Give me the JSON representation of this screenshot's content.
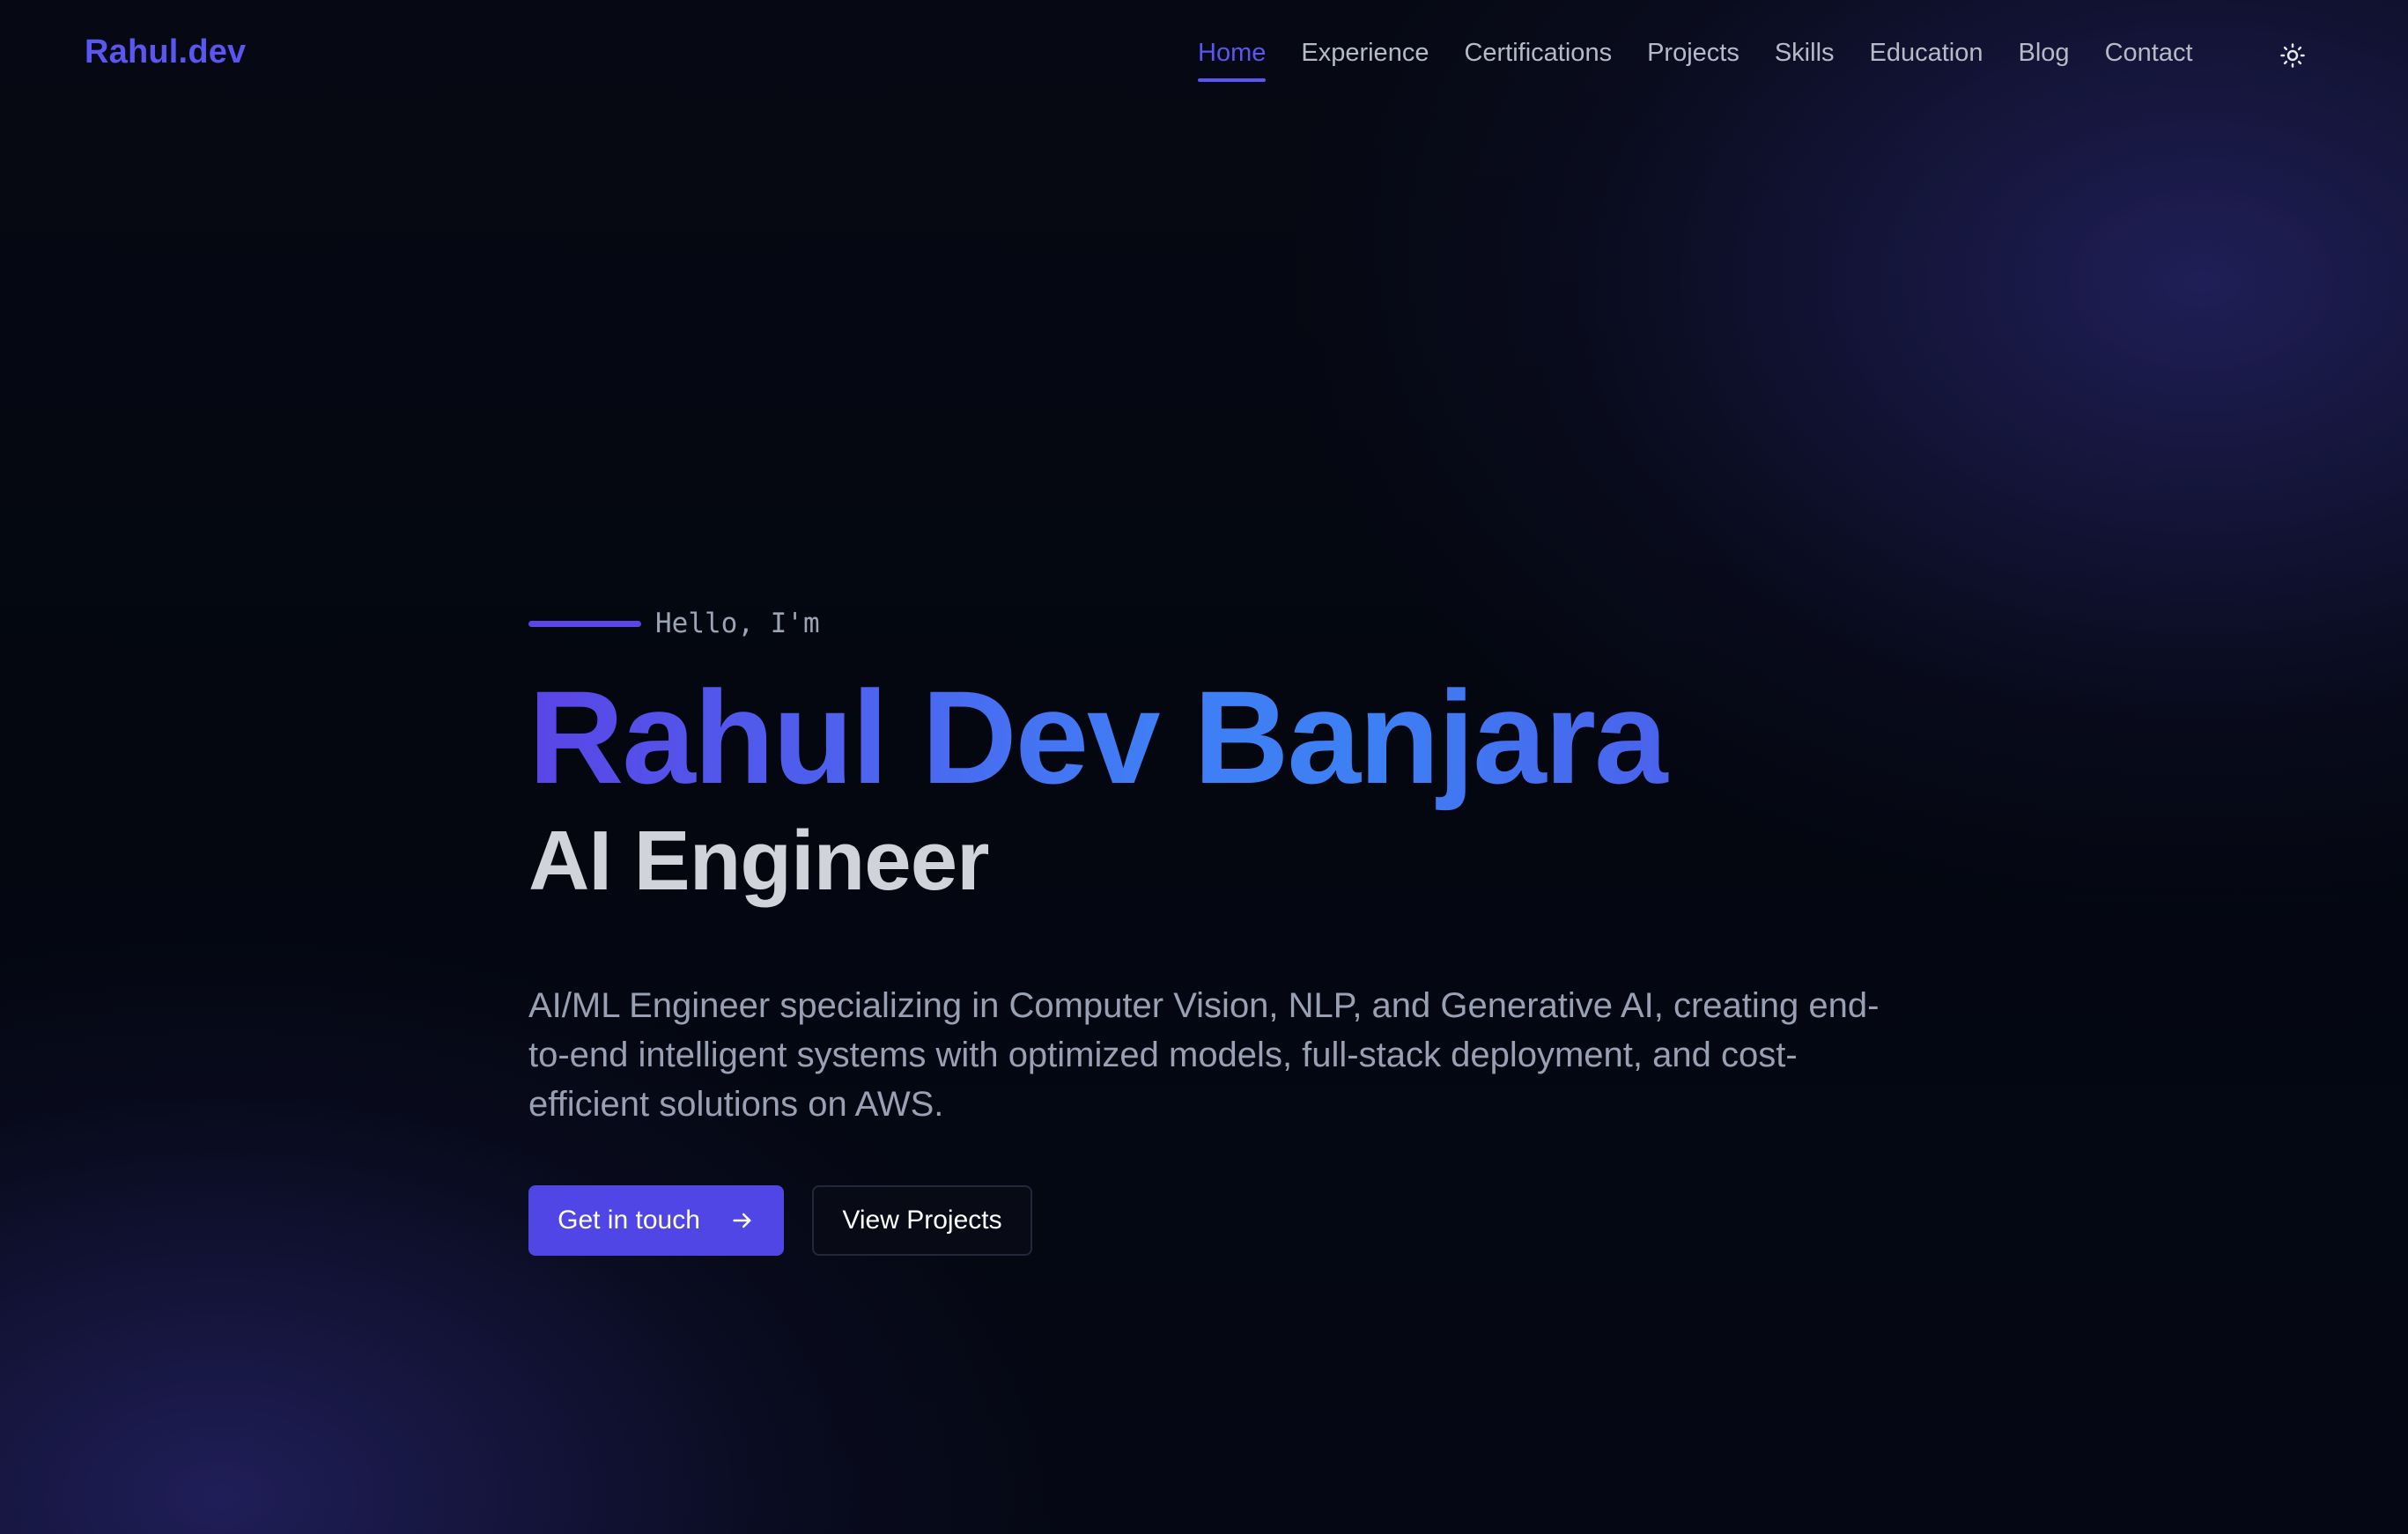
{
  "header": {
    "logo": "Rahul.dev",
    "nav": [
      {
        "label": "Home",
        "active": true
      },
      {
        "label": "Experience",
        "active": false
      },
      {
        "label": "Certifications",
        "active": false
      },
      {
        "label": "Projects",
        "active": false
      },
      {
        "label": "Skills",
        "active": false
      },
      {
        "label": "Education",
        "active": false
      },
      {
        "label": "Blog",
        "active": false
      },
      {
        "label": "Contact",
        "active": false
      }
    ],
    "theme_toggle_icon": "sun-icon"
  },
  "hero": {
    "greeting": "Hello, I'm",
    "name": "Rahul Dev Banjara",
    "role": "AI Engineer",
    "description": "AI/ML Engineer specializing in Computer Vision, NLP, and Generative AI, creating end-to-end intelligent systems with optimized models, full-stack deployment, and cost-efficient solutions on AWS.",
    "primary_cta": "Get in touch",
    "primary_cta_icon": "arrow-right-icon",
    "secondary_cta": "View Projects"
  },
  "colors": {
    "accent": "#5b55f2",
    "button_primary": "#4f46e5",
    "background": "#050814",
    "name_gradient": [
      "#5a45e6",
      "#3f7ff5",
      "#5746e4"
    ]
  }
}
